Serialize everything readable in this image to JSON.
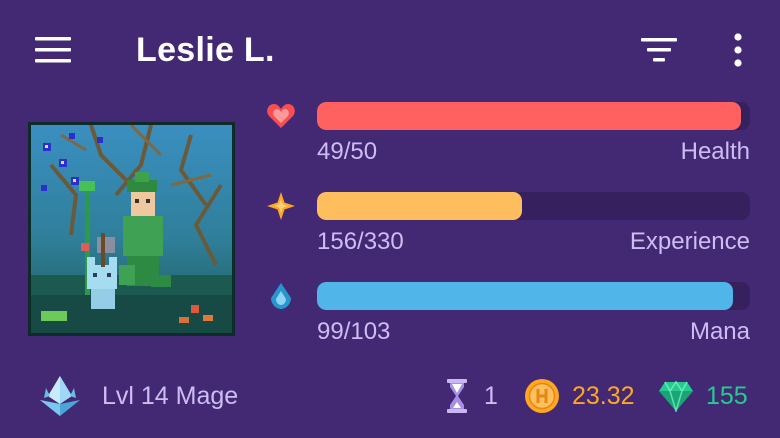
{
  "header": {
    "title": "Leslie L.",
    "menu_icon": "hamburger-menu-icon",
    "filter_icon": "filter-icon",
    "more_icon": "more-vertical-icon"
  },
  "avatar": {
    "icon": "pixel-avatar-image"
  },
  "stats": {
    "health": {
      "value": "49/50",
      "label": "Health",
      "current": 49,
      "max": 50,
      "color": "#ff6060",
      "icon": "heart-icon"
    },
    "experience": {
      "value": "156/330",
      "label": "Experience",
      "current": 156,
      "max": 330,
      "color": "#ffbe5d",
      "icon": "star-icon"
    },
    "mana": {
      "value": "99/103",
      "label": "Mana",
      "current": 99,
      "max": 103,
      "color": "#50b5e9",
      "icon": "mana-drop-icon"
    }
  },
  "footer": {
    "level_text": "Lvl 14 Mage",
    "class_icon": "mage-crystal-icon",
    "hourglass_count": "1",
    "hourglass_icon": "hourglass-icon",
    "gold": "23.32",
    "gold_icon": "gold-coin-icon",
    "gems": "155",
    "gem_icon": "gem-icon"
  },
  "colors": {
    "background": "#432874",
    "bar_track": "#36215e",
    "stat_text": "#cdbdf3",
    "gold_text": "#ffa623",
    "gem_text": "#24cc8f"
  }
}
